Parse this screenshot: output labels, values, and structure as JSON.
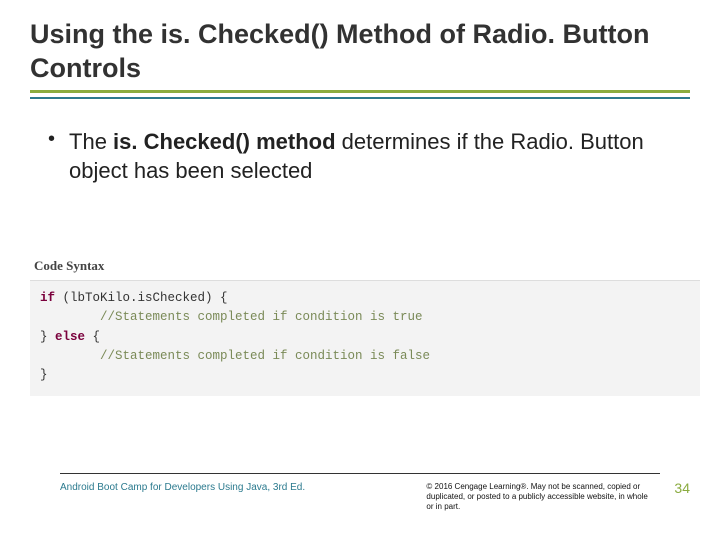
{
  "title": "Using the is. Checked() Method of Radio. Button Controls",
  "bullet": {
    "lead": "The ",
    "bold": "is. Checked() method",
    "rest": " determines if the Radio. Button object has been selected"
  },
  "code": {
    "label": "Code Syntax",
    "kw_if": "if",
    "cond": " (lbToKilo.isChecked) {",
    "comment_true": "        //Statements completed if condition is true",
    "brace_else_open": "} ",
    "kw_else": "else",
    "brace_after_else": " {",
    "comment_false": "        //Statements completed if condition is false",
    "brace_close": "}"
  },
  "footer": {
    "book": "Android Boot Camp for Developers Using Java, 3rd Ed.",
    "copyright": "© 2016 Cengage Learning®. May not be scanned, copied or duplicated, or posted to a publicly accessible website, in whole or in part.",
    "page": "34"
  }
}
